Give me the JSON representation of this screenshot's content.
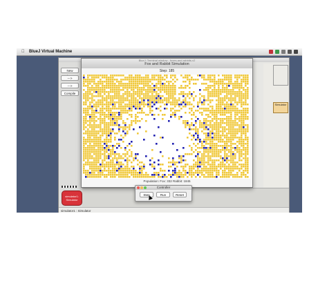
{
  "menubar": {
    "apple": "",
    "app_name": "BlueJ Virtual Machine"
  },
  "bluej": {
    "buttons": [
      "New Class...",
      "--->",
      "--->",
      "Compile"
    ],
    "status_text": "simulator1 : Simulator",
    "object_label_line1": "simulator1:",
    "object_label_line2": "Simulator",
    "right_class_label": "Simulator"
  },
  "simulator": {
    "window_title_small": "BlueJ: Terminal window - foxes-and-rabbits-v2",
    "window_title": "Fox and Rabbit Simulation",
    "step_text": "Step: 185",
    "population_text": "Population: Fox: 332 Rabbit: 1845",
    "colors": {
      "rabbit": "#f0c93c",
      "fox": "#1f1fb0",
      "empty": "#ffffff"
    }
  },
  "controller": {
    "title": "Controller",
    "step_label": "Step",
    "run_label": "Run",
    "reset_label": "Reset",
    "traffic": [
      "#ee5a52",
      "#f5bd4f",
      "#5fc750"
    ]
  }
}
